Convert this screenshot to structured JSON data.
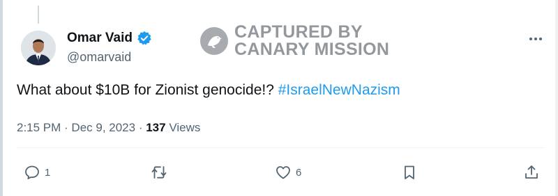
{
  "author": {
    "display_name": "Omar Vaid",
    "handle": "@omarvaid",
    "verified": true
  },
  "watermark": {
    "line1": "CAPTURED BY",
    "line2": "CANARY MISSION"
  },
  "tweet": {
    "text": "What about $10B for Zionist genocide!? ",
    "hashtag": "#IsraelNewNazism"
  },
  "meta": {
    "time": "2:15 PM",
    "separator": " · ",
    "date": "Dec 9, 2023",
    "views_count": "137",
    "views_label": " Views"
  },
  "actions": {
    "reply_count": "1",
    "like_count": "6"
  },
  "icons": {
    "verified": "verified-badge-icon",
    "more": "more-options-icon",
    "reply": "reply-icon",
    "retweet": "retweet-icon",
    "like": "heart-icon",
    "bookmark": "bookmark-icon",
    "share": "share-icon"
  },
  "colors": {
    "accent": "#1d9bf0",
    "text": "#0f1419",
    "secondary": "#536471"
  }
}
